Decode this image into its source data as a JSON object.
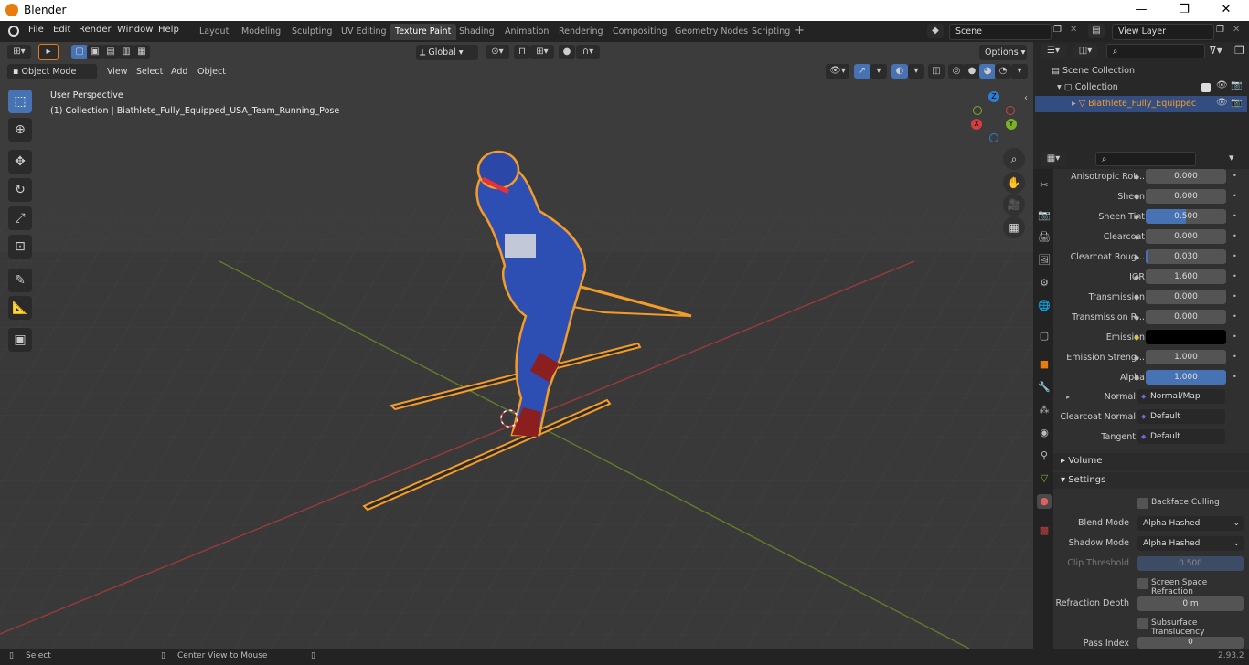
{
  "window": {
    "title": "Blender",
    "min": "—",
    "max": "❐",
    "close": "✕"
  },
  "menu": [
    "File",
    "Edit",
    "Render",
    "Window",
    "Help"
  ],
  "workspaces": [
    "Layout",
    "Modeling",
    "Sculpting",
    "UV Editing",
    "Texture Paint",
    "Shading",
    "Animation",
    "Rendering",
    "Compositing",
    "Geometry Nodes",
    "Scripting"
  ],
  "active_workspace": "Texture Paint",
  "scene": {
    "name": "Scene",
    "view_layer": "View Layer"
  },
  "viewport": {
    "mode": "Object Mode",
    "menus": [
      "View",
      "Select",
      "Add",
      "Object"
    ],
    "orientation": "Global",
    "options": "Options",
    "overlay_title": "User Perspective",
    "overlay_sub": "(1) Collection | Biathlete_Fully_Equipped_USA_Team_Running_Pose",
    "gizmo": {
      "z": "Z",
      "y": "Y",
      "x": "X"
    }
  },
  "outliner": {
    "root": "Scene Collection",
    "collection": "Collection",
    "object": "Biathlete_Fully_Equippec"
  },
  "props": [
    {
      "label": "Anisotropic Rot...",
      "value": "0.000",
      "fill": 0
    },
    {
      "label": "Sheen",
      "value": "0.000",
      "fill": 0
    },
    {
      "label": "Sheen Tint",
      "value": "0.500",
      "fill": 0.5
    },
    {
      "label": "Clearcoat",
      "value": "0.000",
      "fill": 0
    },
    {
      "label": "Clearcoat Roug...",
      "value": "0.030",
      "fill": 0.03
    },
    {
      "label": "IOR",
      "value": "1.600",
      "fill": 0
    },
    {
      "label": "Transmission",
      "value": "0.000",
      "fill": 0
    },
    {
      "label": "Transmission R...",
      "value": "0.000",
      "fill": 0
    },
    {
      "label": "Emission",
      "value": "",
      "fill": 0
    },
    {
      "label": "Emission Streng...",
      "value": "1.000",
      "fill": 0
    },
    {
      "label": "Alpha",
      "value": "1.000",
      "fill": 1
    }
  ],
  "links": [
    {
      "label": "Normal",
      "value": "Normal/Map"
    },
    {
      "label": "Clearcoat Normal",
      "value": "Default"
    },
    {
      "label": "Tangent",
      "value": "Default"
    }
  ],
  "sections": {
    "volume": "Volume",
    "settings": "Settings"
  },
  "settings": {
    "backface": "Backface Culling",
    "blend_label": "Blend Mode",
    "blend": "Alpha Hashed",
    "shadow_label": "Shadow Mode",
    "shadow": "Alpha Hashed",
    "clip_label": "Clip Threshold",
    "clip": "0.500",
    "ssr": "Screen Space Refraction",
    "refr_label": "Refraction Depth",
    "refr": "0 m",
    "sst": "Subsurface Translucency",
    "pass_label": "Pass Index",
    "pass": "0"
  },
  "status": {
    "select": "Select",
    "center": "Center View to Mouse",
    "version": "2.93.2"
  },
  "colors": {
    "accent": "#4772b3",
    "selection": "#f39c2a",
    "x_axis": "#d13f42",
    "y_axis": "#7bb228",
    "z_axis": "#2d7fd6"
  }
}
